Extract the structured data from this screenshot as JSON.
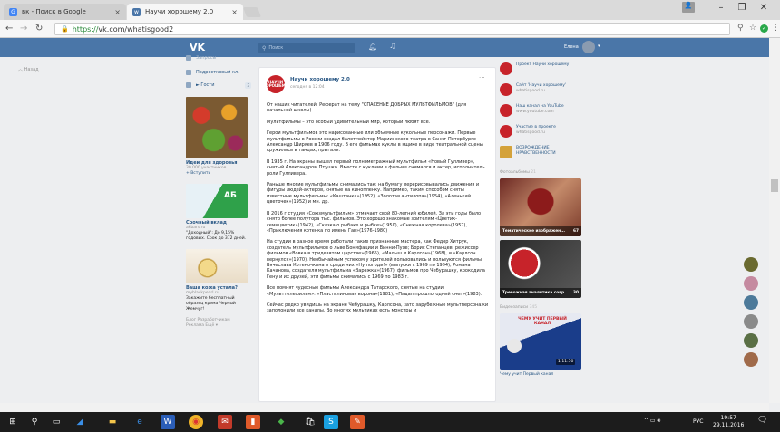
{
  "browser": {
    "tabs": [
      {
        "title": "вк - Поиск в Google"
      },
      {
        "title": "Научи хорошему 2.0"
      }
    ],
    "url_scheme": "https://",
    "url_rest": "vk.com/whatisgood2"
  },
  "vk": {
    "logo": "VK",
    "search_placeholder": "Поиск",
    "user_name": "Елена",
    "back_label": "Назад"
  },
  "left": {
    "top_item": "Запросы",
    "nav": [
      {
        "label": "Подростковый кл.",
        "count": ""
      },
      {
        "label": "► Гости",
        "count": "3"
      }
    ],
    "ads": [
      {
        "title": "Идеи для здоровья",
        "sub1": "30 000 участников",
        "sub2": "+ Вступить",
        "text": ""
      },
      {
        "title": "Срочный вклад",
        "sub1": "akbars.ru",
        "sub2": "",
        "text": "\"Доходный\": До 9,15% годовых. Срок до 372 дней."
      },
      {
        "title": "Ваша кожа устала?",
        "sub1": "myblackpearl.ru",
        "sub2": "",
        "text": "Закажите бесплатный образец крема Черный Жемчуг!"
      }
    ],
    "footer": [
      "Блог  Разработчикам",
      "Реклама  Ещё ▾"
    ]
  },
  "post": {
    "avatar_text": "НАУЧИ ХОРОШЕМУ",
    "author": "Научи хорошему 2.0",
    "date": "сегодня в 12:04",
    "more": "···",
    "paragraphs": [
      "От наших читателей: Реферат на тему \"СПАСЕНИЕ ДОБРЫХ МУЛЬТФИЛЬМОВ\" (для начальной школы)",
      "Мультфильмы – это особый удивительный мир, который любят все.",
      "Герои мультфильмов это нарисованные или объемные кукольные персонажи. Первые мультфильмы в России создал балетмейстер Мариинского театра в Санкт-Петербурге Александр Ширяев в 1906 году. В его фильмах куклы в ящике в виде театральной сцены кружились в танцах, прыгали.",
      "В 1935 г. На экраны вышел первый полнометражный мультфильм «Новый Гулливер», снятый Александром Птушко. Вместе с куклами в фильме снимался и актер, исполнитель роли Гулливера.",
      "Раньше многие мультфильмы снимались так: на бумагу перерисовывались движения и фигуры людей-актеров, снятые на кинопленку. Например, таким способом сняты известные мультфильмы: «Каштанка»(1952), «Золотая антилопа»(1954), «Аленький цветочек»(1952) и мн. др.",
      "В 2016 г студия «Союзмультфильм» отмечает свой 80-летний юбилей. За эти годы было снято более полутора тыс. фильмов. Это хорошо знакомые зрителям «Цветик-семицветик»(1942), «Сказка о рыбаке и рыбке»(1950), «Снежная королева»(1957), «Приключения котенка по имени Гав»(1976-1980)",
      "На студии в разное время работали такие признанные мастера, как Федор Хитрук, создатель мультфильмов о льве Бонифации и Винни-Пухе; Борис Степанцев, режиссер фильмов «Вовка в тридевятом царстве»(1965), «Малыш и Карлсон»(1968), и «Карлсон вернулся»(1970). Необычайным успехом у зрителей пользовались и пользуются фильмы Вячеслава Котеночкина и среди них «Ну погоди!» (выпуски с 1969 по 1994); Романа Качанова, создателя мультфильма «Варежка»(1967), фильмов про Чебурашку, крокодила Гену и их друзей, эти фильмы снимались с 1969 по 1983 г.",
      "Все помнят чудесные фильмы Александра Татарского, снятые на студии «Мульттелефильм»: «Пластилиновая ворона»(1981), «Падал прошлогодний снег»(1983).",
      "Сейчас редко увидишь на экране Чебурашку, Карлсона, зато зарубежные мультперсонажи заполонили все каналы. Во многих мультиках есть монстры и"
    ]
  },
  "right": {
    "links": [
      {
        "title": "Проект Научи хорошему",
        "sub": "",
        "color": "#c7232a"
      },
      {
        "title": "Сайт 'Научи хорошему'",
        "sub": "whatisgood.ru",
        "color": "#c7232a"
      },
      {
        "title": "Наш канал на YouTube",
        "sub": "www.youtube.com",
        "color": "#c7232a"
      },
      {
        "title": "Участие в проекте",
        "sub": "whatisgood.ru",
        "color": "#c7232a"
      },
      {
        "title": "ВОЗРОЖДЕНИЕ НРАВСТВЕННОСТИ",
        "sub": "",
        "color": "#d4a23a"
      }
    ],
    "photos_label": "Фотоальбомы",
    "photos_count": "21",
    "albums": [
      {
        "caption": "Тематические изображен...",
        "count": "67"
      },
      {
        "caption": "Тревожная аналитика совр...",
        "count": "30"
      }
    ],
    "videos_label": "Видеозаписи",
    "videos_count": "745",
    "video_channel": "ЧЕМУ УЧИТ ПЕРВЫЙ КАНАЛ",
    "video_duration": "1:11:50",
    "video_caption": "Чему учит Первый канал"
  },
  "taskbar": {
    "lang": "РУС",
    "time": "19:57",
    "date": "29.11.2016"
  }
}
